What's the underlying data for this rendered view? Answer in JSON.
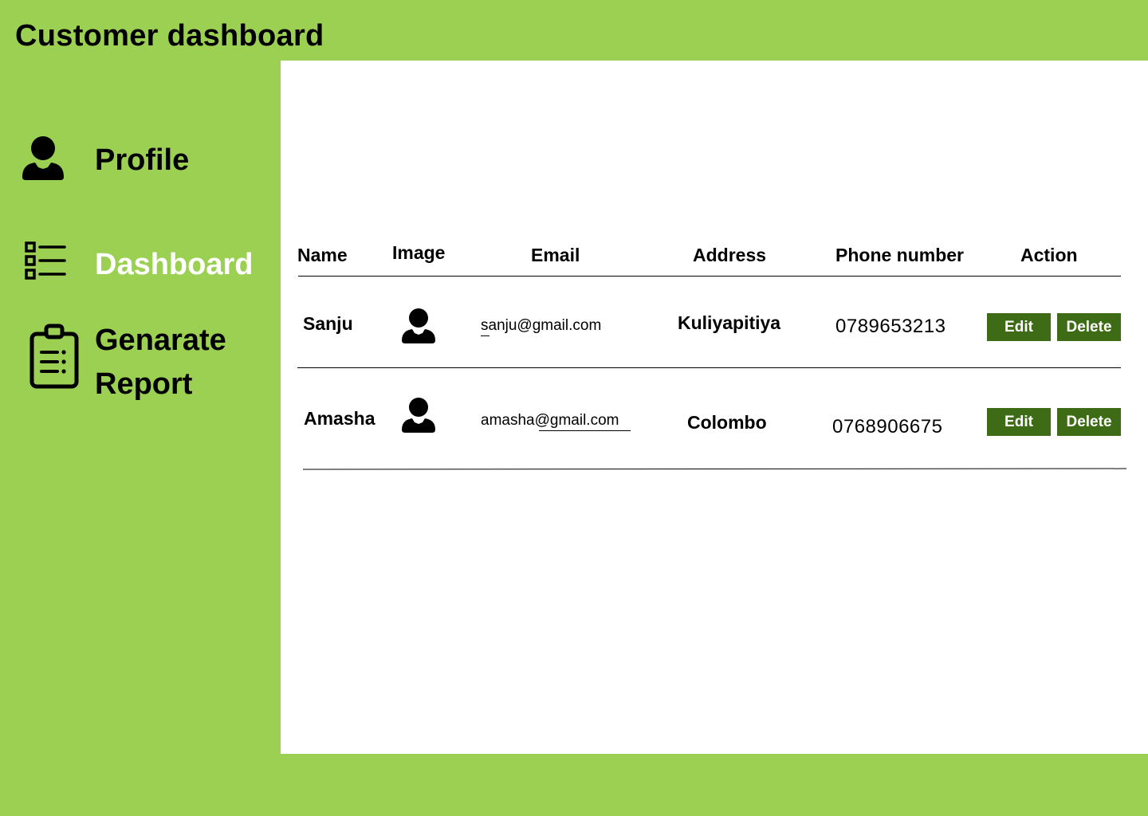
{
  "app": {
    "title": "Customer dashboard"
  },
  "sidebar": {
    "items": [
      {
        "label": "Profile",
        "icon": "user-icon",
        "active": false
      },
      {
        "label": "Dashboard",
        "icon": "list-icon",
        "active": true
      },
      {
        "label": "Genarate Report",
        "icon": "clipboard-report-icon",
        "active": false
      }
    ]
  },
  "table": {
    "columns": [
      "Name",
      "Image",
      "Email",
      "Address",
      "Phone number",
      "Action"
    ],
    "rows": [
      {
        "name": "Sanju",
        "image": "user-avatar-icon",
        "email": "sanju@gmail.com",
        "address": "Kuliyapitiya",
        "phone": "0789653213",
        "actions": [
          "Edit",
          "Delete"
        ]
      },
      {
        "name": "Amasha",
        "image": "user-avatar-icon",
        "email": "amasha@gmail.com",
        "address": "Colombo",
        "phone": "0768906675",
        "actions": [
          "Edit",
          "Delete"
        ]
      }
    ]
  },
  "colors": {
    "background": "#9bd052",
    "panel": "#ffffff",
    "button": "#3e6b16",
    "active_nav_text": "#ffffff"
  }
}
